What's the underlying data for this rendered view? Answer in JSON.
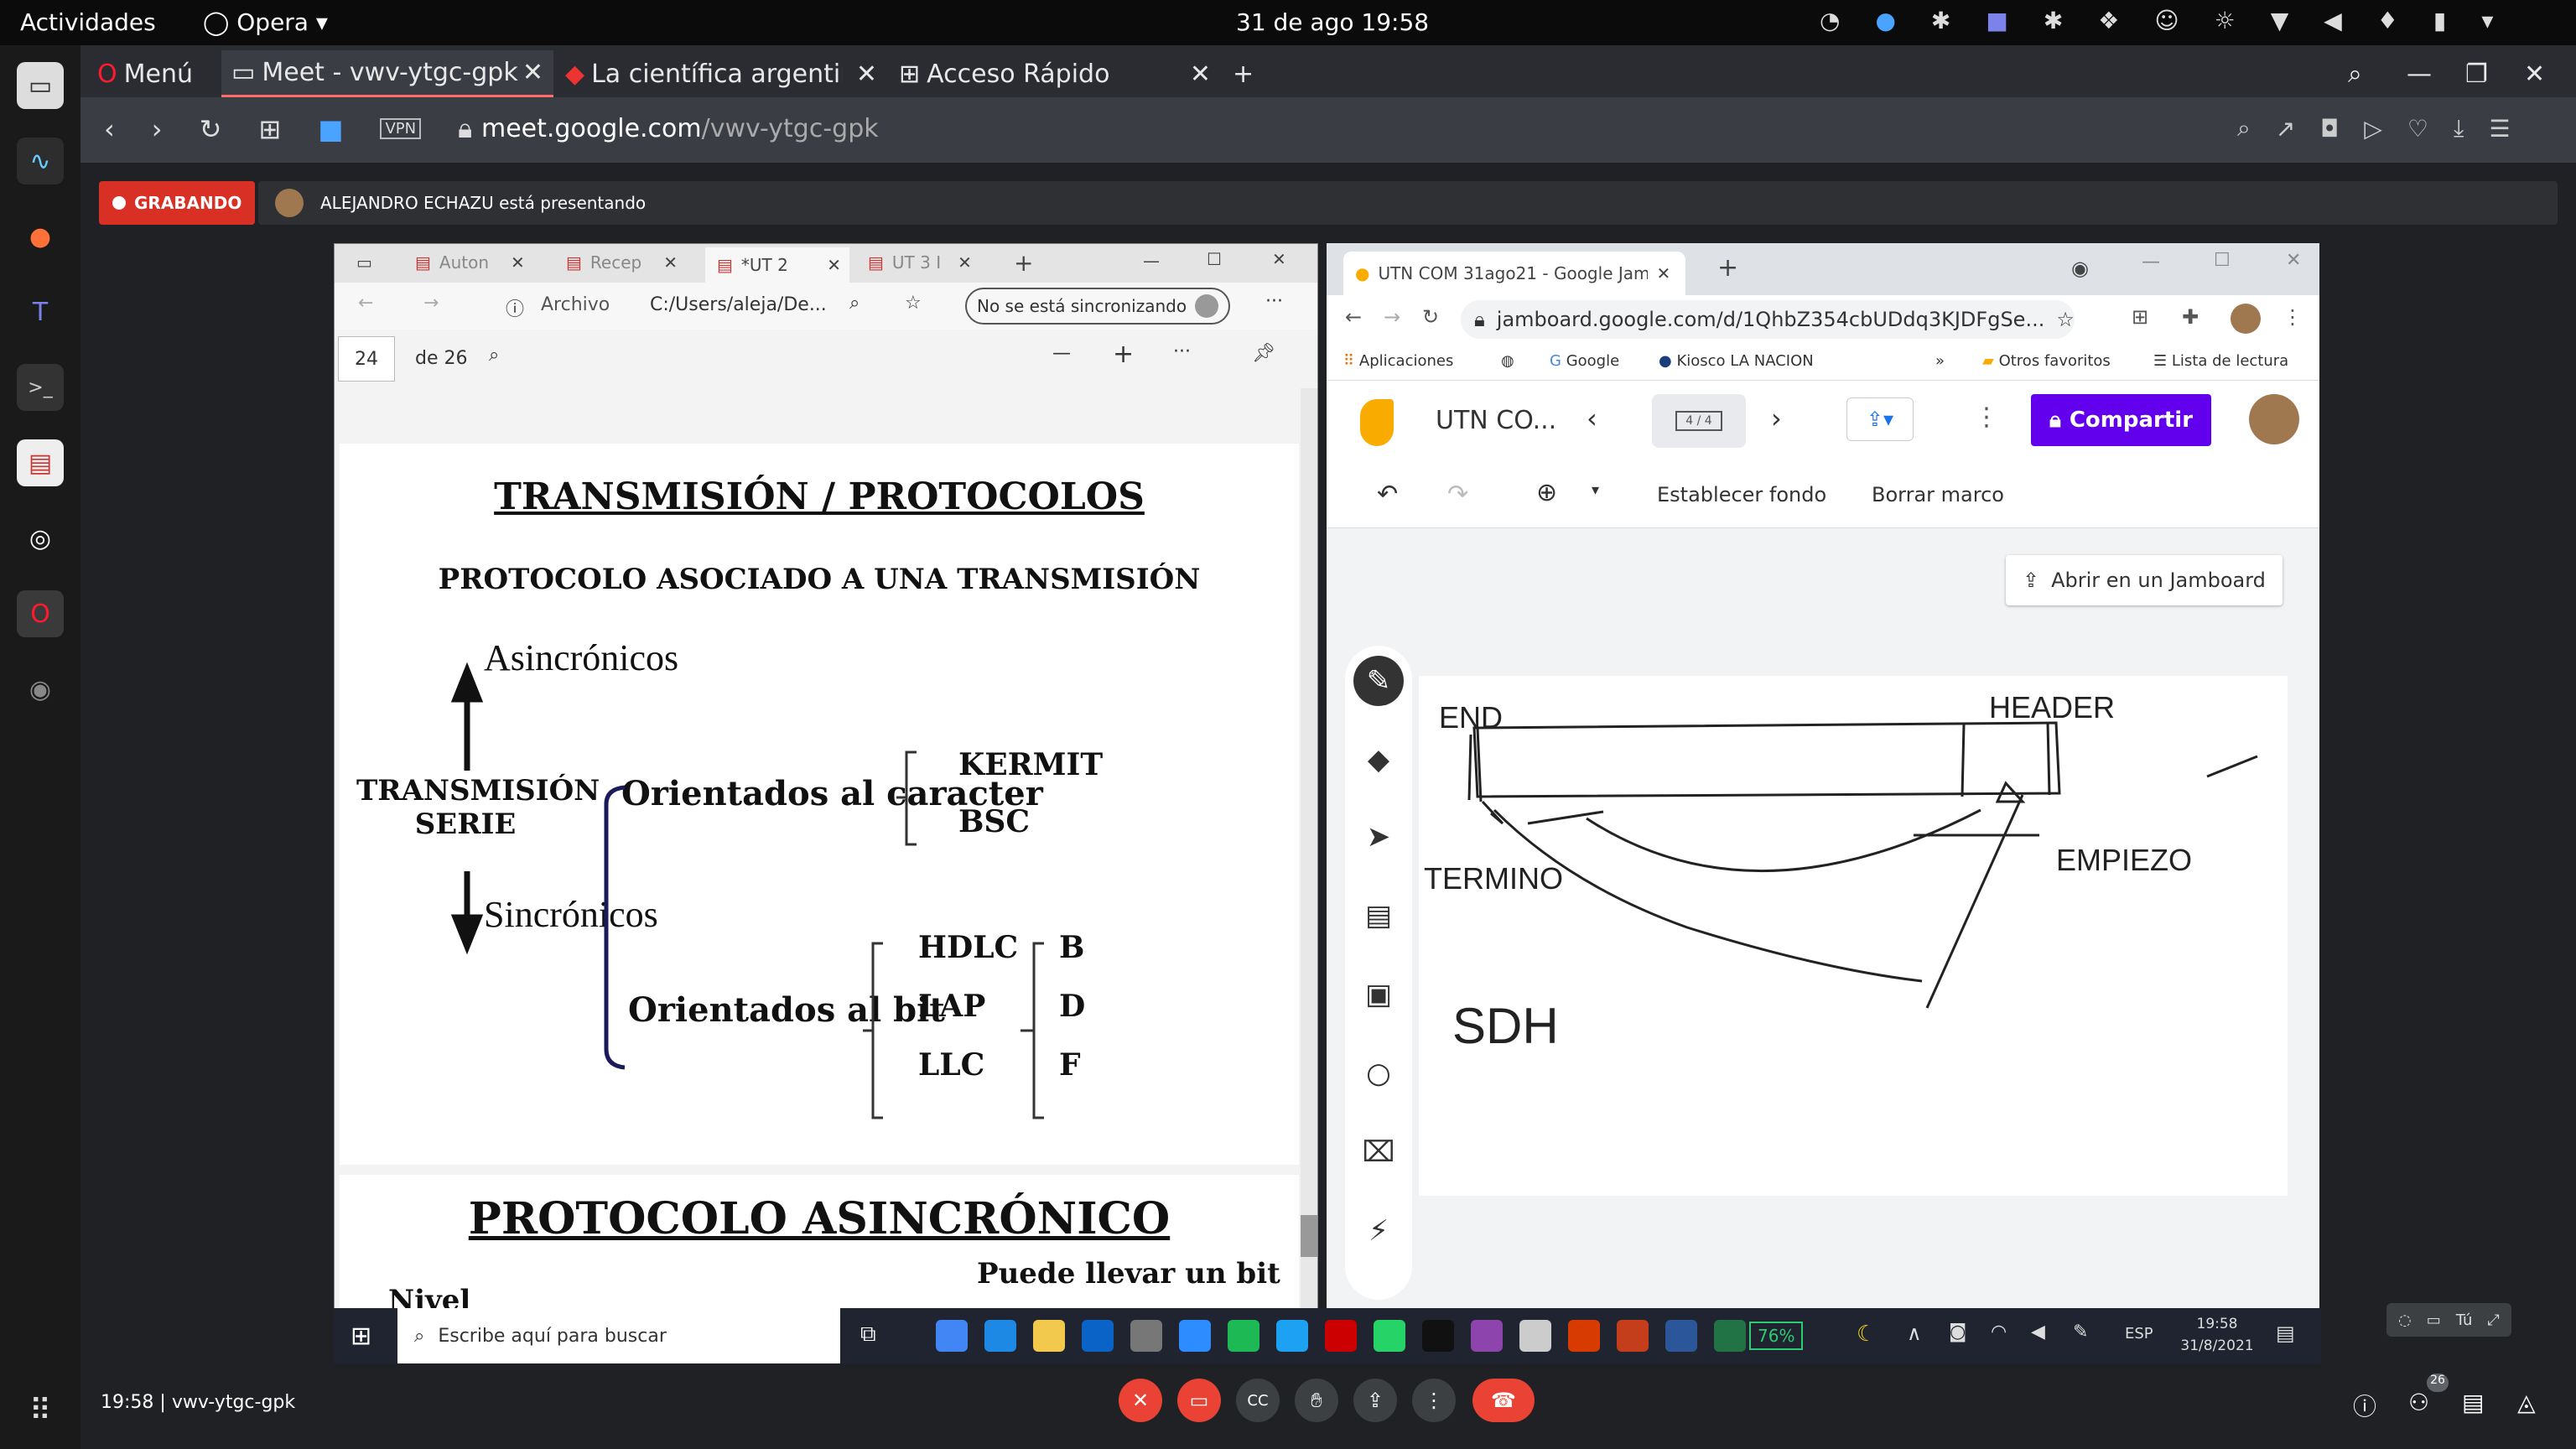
{
  "topbar": {
    "activities": "Actividades",
    "app": "Opera",
    "datetime": "31 de ago  19:58"
  },
  "opera": {
    "menu": "Menú",
    "tabs": [
      {
        "label": "Meet - vwv-ytgc-gpk"
      },
      {
        "label": "La científica argentin"
      },
      {
        "label": "Acceso Rápido"
      }
    ],
    "url_host": "meet.google.com",
    "url_path": "/vwv-ytgc-gpk",
    "vpn": "VPN"
  },
  "meet": {
    "recording": "GRABANDO",
    "presenting": "ALEJANDRO ECHAZU está presentando",
    "time": "19:58",
    "code": "vwv-ytgc-gpk",
    "participants": "26",
    "you": "Tú"
  },
  "pdf": {
    "tabs": [
      "Auton",
      "Recep",
      "*UT 2",
      "UT 3 I"
    ],
    "archivo": "Archivo",
    "path": "C:/Users/aleja/De...",
    "sync": "No se está sincronizando",
    "page": "24",
    "of": "de 26",
    "page1": {
      "title": "TRANSMISIÓN / PROTOCOLOS",
      "subtitle": "PROTOCOLO ASOCIADO A UNA TRANSMISIÓN",
      "asinc": "Asincrónicos",
      "serie1": "TRANSMISIÓN",
      "serie2": "SERIE",
      "sinc": "Sincrónicos",
      "caracter": "Orientados al caracter",
      "kermit": "KERMIT",
      "bsc": "BSC",
      "bit": "Orientados al bit",
      "hdlc": "HDLC",
      "lap": "LAP",
      "llc": "LLC",
      "b": "B",
      "d": "D",
      "f": "F"
    },
    "page2": {
      "title": "PROTOCOLO ASINCRÓNICO",
      "bit_note": "Puede llevar un bit",
      "nivel": "Nivel"
    }
  },
  "jam": {
    "tab": "UTN COM 31ago21 - Google Jambo",
    "url": "jamboard.google.com/d/1QhbZ354cbUDdq3KJDFgSe...",
    "bookmarks": [
      "Aplicaciones",
      "Google",
      "Kiosco LA NACION",
      "Otros favoritos",
      "Lista de lectura"
    ],
    "title": "UTN CO...",
    "frame": "4 / 4",
    "share": "Compartir",
    "set_bg": "Establecer fondo",
    "clear": "Borrar marco",
    "open_in": "Abrir en un Jamboard",
    "labels": {
      "end": "END",
      "header": "HEADER",
      "termino": "TERMINO",
      "empiezo": "EMPIEZO",
      "sdh": "SDH"
    }
  },
  "taskbar": {
    "search": "Escribe aquí para buscar",
    "battery": "76%",
    "lang": "ESP",
    "time": "19:58",
    "date": "31/8/2021"
  }
}
